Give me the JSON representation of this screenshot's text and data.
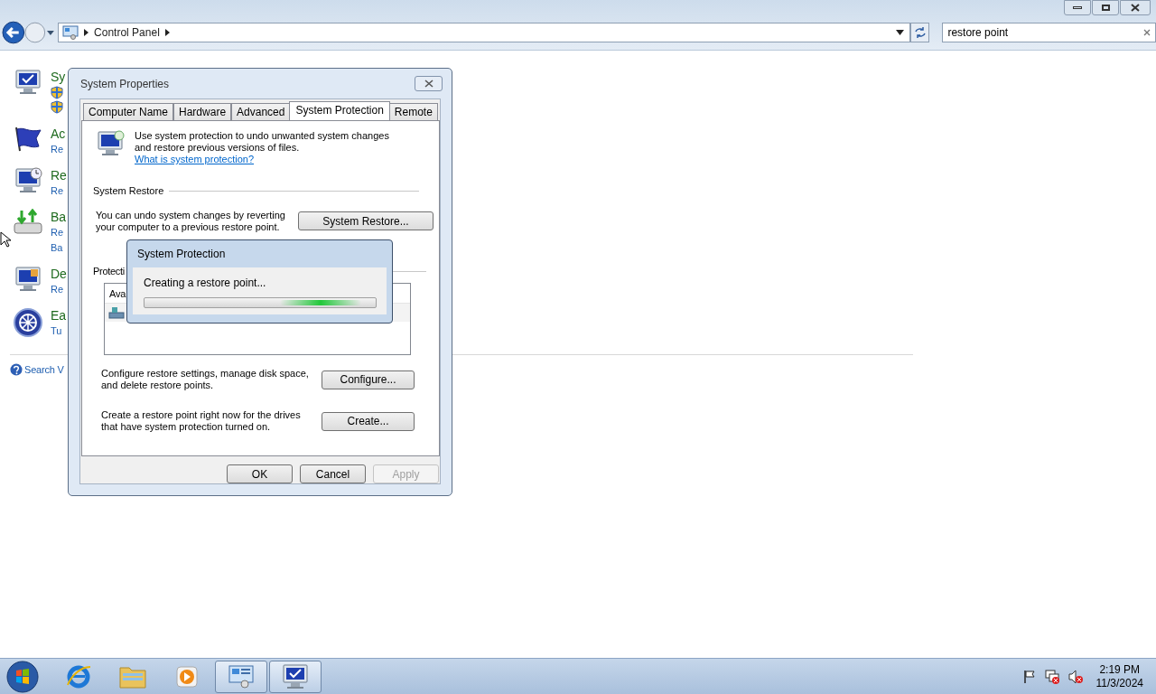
{
  "explorer": {
    "breadcrumb": [
      "Control Panel"
    ],
    "search": {
      "value": "restore point"
    }
  },
  "results": [
    {
      "kind": "system",
      "title": "Sy",
      "links": [
        {
          "kind": "shield"
        },
        {
          "kind": "shield"
        }
      ]
    },
    {
      "kind": "flag",
      "title": "Ac",
      "links": [
        {
          "kind": "text",
          "text": "Re"
        }
      ]
    },
    {
      "kind": "restore",
      "title": "Re",
      "links": [
        {
          "kind": "text",
          "text": "Re"
        }
      ]
    },
    {
      "kind": "backup",
      "title": "Ba",
      "links": [
        {
          "kind": "text",
          "text": "Re"
        },
        {
          "kind": "text",
          "text": "Ba"
        }
      ]
    },
    {
      "kind": "display",
      "title": "De",
      "links": [
        {
          "kind": "text",
          "text": "Re"
        }
      ]
    },
    {
      "kind": "ease",
      "title": "Ea",
      "links": [
        {
          "kind": "text",
          "text": "Tu"
        }
      ]
    }
  ],
  "search_help": "Search V",
  "dialog": {
    "title": "System Properties",
    "tabs": [
      {
        "label": "Computer Name",
        "selected": false
      },
      {
        "label": "Hardware",
        "selected": false
      },
      {
        "label": "Advanced",
        "selected": false
      },
      {
        "label": "System Protection",
        "selected": true
      },
      {
        "label": "Remote",
        "selected": false
      }
    ],
    "intro": "Use system protection to undo unwanted system changes and restore previous versions of files.",
    "intro_link": "What is system protection?",
    "restore_group": "System Restore",
    "restore_text": "You can undo system changes by reverting your computer to a previous restore point.",
    "restore_button": "System Restore...",
    "protection_group": "Protecti",
    "list_header": "Ava",
    "configure_text": "Configure restore settings, manage disk space, and delete restore points.",
    "configure_button": "Configure...",
    "create_text": "Create a restore point right now for the drives that have system protection turned on.",
    "create_button": "Create...",
    "buttons": [
      {
        "label": "OK",
        "disabled": false
      },
      {
        "label": "Cancel",
        "disabled": false
      },
      {
        "label": "Apply",
        "disabled": true
      }
    ]
  },
  "progress": {
    "title": "System Protection",
    "message": "Creating a restore point...",
    "indeterminate": true
  },
  "taskbar": {
    "apps": [
      {
        "kind": "ie",
        "open": false
      },
      {
        "kind": "folder",
        "open": false
      },
      {
        "kind": "media",
        "open": false
      },
      {
        "kind": "control",
        "open": true
      },
      {
        "kind": "sysprops",
        "open": true
      }
    ],
    "time": "2:19 PM",
    "date": "11/3/2024"
  }
}
